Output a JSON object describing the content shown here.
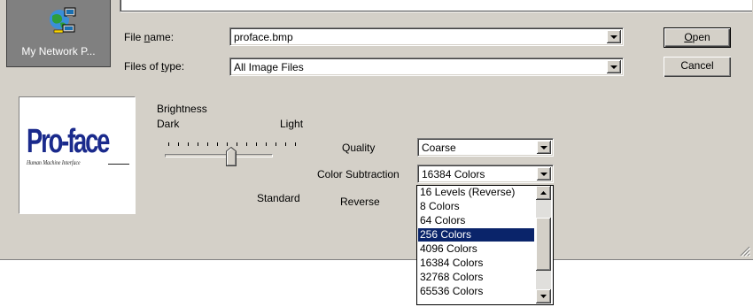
{
  "places": {
    "label": "My Network P..."
  },
  "form": {
    "file_name_label_prefix": "File ",
    "file_name_label_u": "n",
    "file_name_label_suffix": "ame:",
    "file_name_value": "proface.bmp",
    "file_type_label_prefix": "Files of ",
    "file_type_label_u": "t",
    "file_type_label_suffix": "ype:",
    "file_type_value": "All Image Files"
  },
  "buttons": {
    "open_u": "O",
    "open_rest": "pen",
    "cancel": "Cancel"
  },
  "preview": {
    "logo_text": "Pro-face",
    "logo_subtext": "Human Machine Interface"
  },
  "brightness": {
    "title": "Brightness",
    "dark": "Dark",
    "light": "Light",
    "level": 0.55
  },
  "options": {
    "quality_label": "Quality",
    "quality_value": "Coarse",
    "color_sub_label": "Color Subtraction",
    "color_sub_value": "16384 Colors",
    "standard_label": "Standard",
    "reverse_label": "Reverse"
  },
  "color_list": {
    "items": [
      "16 Levels (Reverse)",
      "8 Colors",
      "64 Colors",
      "256 Colors",
      "4096 Colors",
      "16384 Colors",
      "32768 Colors",
      "65536 Colors"
    ],
    "selected_index": 3
  },
  "colors": {
    "selection": "#0a246a",
    "dialog": "#d4d0c8",
    "places_bg": "#808080"
  }
}
